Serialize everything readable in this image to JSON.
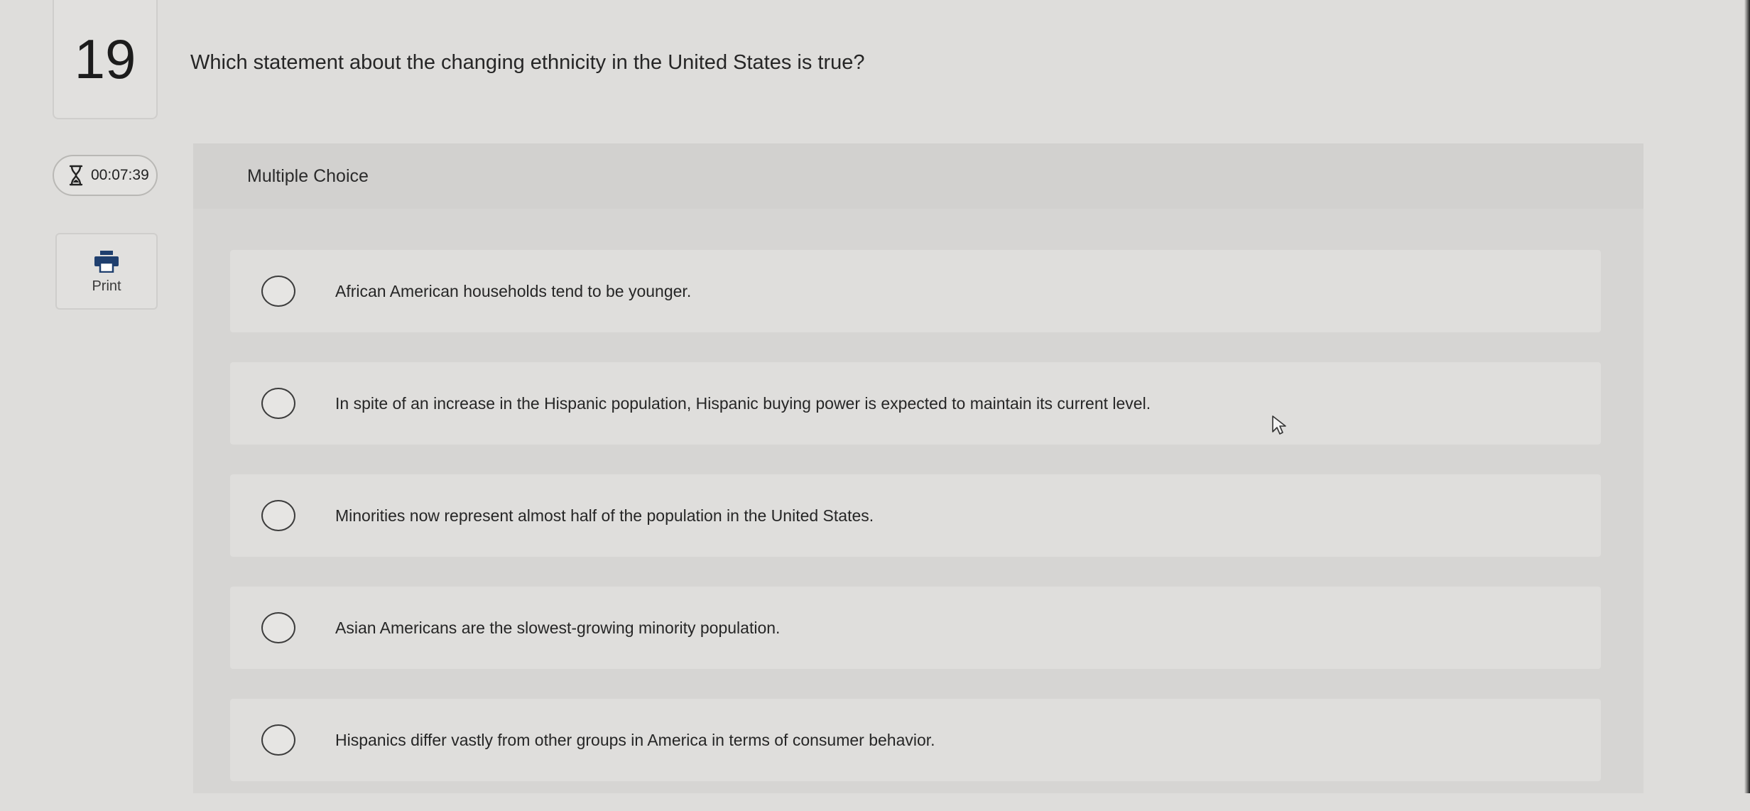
{
  "question": {
    "number": "19",
    "text": "Which statement about the changing ethnicity in the United States is true?"
  },
  "timer": {
    "value": "00:07:39",
    "icon": "hourglass-icon"
  },
  "print": {
    "label": "Print",
    "icon": "printer-icon"
  },
  "multiple_choice": {
    "header": "Multiple Choice",
    "options": [
      {
        "label": "African American households tend to be younger."
      },
      {
        "label": "In spite of an increase in the Hispanic population, Hispanic buying power is expected to maintain its current level."
      },
      {
        "label": "Minorities now represent almost half of the population in the United States."
      },
      {
        "label": "Asian Americans are the slowest-growing minority population."
      },
      {
        "label": "Hispanics differ vastly from other groups in America in terms of consumer behavior."
      }
    ]
  }
}
